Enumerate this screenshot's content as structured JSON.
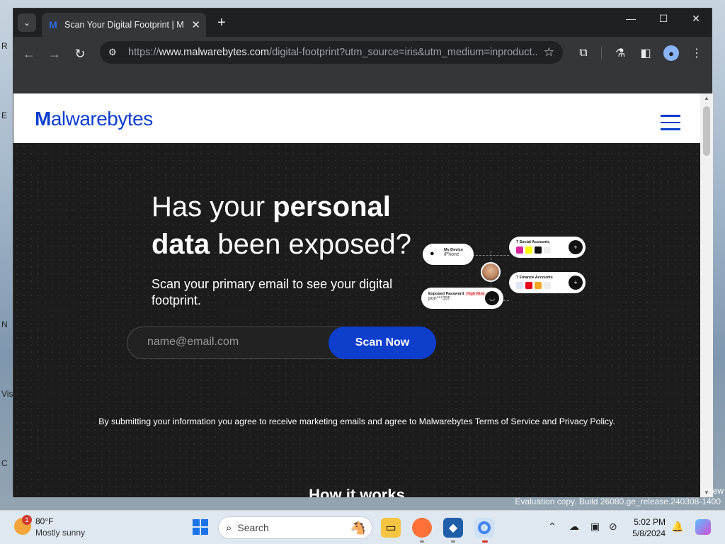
{
  "desktop": {
    "left_labels": [
      "R",
      "E",
      "N",
      "Vis",
      "C"
    ],
    "right_label": "ew",
    "eval_text": "Evaluation copy. Build 26080.ge_release.240308-1400"
  },
  "browser": {
    "tab_title": "Scan Your Digital Footprint | M",
    "favicon": "M",
    "url_host": "www.malwarebytes.com",
    "url_prefix": "https://",
    "url_rest": "/digital-footprint?utm_source=iris&utm_medium=inproduct...",
    "icons": {
      "back": "←",
      "forward": "→",
      "reload": "↻",
      "new_tab": "+",
      "close_tab": "✕",
      "star": "☆",
      "extensions": "⧉",
      "labs": "⚗",
      "sidepanel": "◧",
      "menu": "⋮",
      "minimize": "—",
      "maximize": "☐",
      "close": "✕",
      "tab_menu": "⌄",
      "site_info": "⚙"
    }
  },
  "page": {
    "logo_m": "M",
    "logo_rest": "alwarebytes",
    "headline_part1": "Has your ",
    "headline_bold1": "personal",
    "headline_bold2": "data",
    "headline_part2": " been exposed?",
    "subline": "Scan your primary email to see your digital footprint.",
    "email_placeholder": "name@email.com",
    "scan_button": "Scan Now",
    "disclaimer": "By submitting your information you agree to receive marketing emails and agree to Malwarebytes Terms of Service and Privacy Policy.",
    "how_it_works": "How it works"
  },
  "illustration": {
    "device_title": "My Device",
    "device_value": "iPhone",
    "social_title": "7 Social Accounts",
    "finance_title": "7 Finance Accounts",
    "password_title": "Exposed Password",
    "password_badge": "High Risk",
    "password_value": "pon***39!!",
    "plus": "+"
  },
  "taskbar": {
    "temp": "80°F",
    "condition": "Mostly sunny",
    "weather_badge": "1",
    "search_placeholder": "Search",
    "time": "5:02 PM",
    "date": "5/8/2024"
  }
}
